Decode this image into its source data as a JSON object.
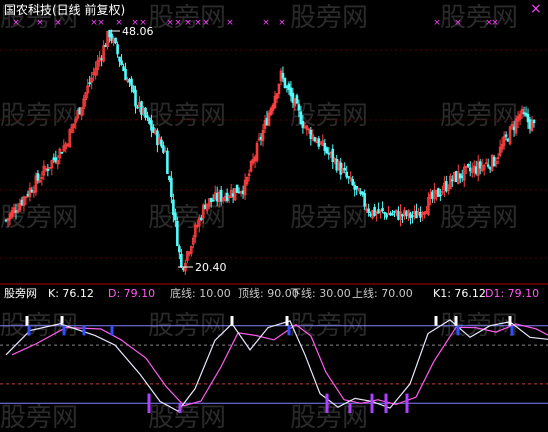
{
  "header": {
    "title": "国农科技(日线 前复权)",
    "close_label": "×"
  },
  "main_panel": {
    "high_label": "48.06",
    "low_label": "20.40",
    "markers": [
      16,
      40,
      58,
      94,
      101,
      119,
      135,
      143,
      170,
      178,
      188,
      198,
      206,
      230,
      266,
      282,
      437,
      458,
      489,
      495
    ]
  },
  "indicator_panel": {
    "name": "股旁网",
    "params": [
      {
        "label": "K: 76.12",
        "color": "#ffffff"
      },
      {
        "label": "D: 79.10",
        "color": "#ff5cf0"
      },
      {
        "label": "底线: 10.00",
        "color": "#c8c8c8"
      },
      {
        "label": "顶线: 90.00",
        "color": "#c8c8c8"
      },
      {
        "label": "下线: 30.00",
        "color": "#c8c8c8"
      },
      {
        "label": "上线: 70.00",
        "color": "#c8c8c8"
      },
      {
        "label": "K1: 76.12",
        "color": "#ffffff"
      },
      {
        "label": "D1: 79.10",
        "color": "#ff5cf0"
      }
    ]
  },
  "watermark": "股旁网",
  "colors": {
    "up": "#ff4040",
    "down": "#54fcfc",
    "axis_red": "#b00000",
    "k_line": "#e8e8ff",
    "d_line": "#ff5cf0",
    "top_bar": "#ffffff",
    "blue_bar": "#3050ff",
    "purple_bar": "#b040ff",
    "marker": "#ff40ff",
    "watermark": "#2a2a2a"
  },
  "chart_data": [
    {
      "type": "candlestick",
      "title": "国农科技(日线 前复权)",
      "annotations": [
        {
          "text": "48.06",
          "value": 48.06,
          "kind": "high"
        },
        {
          "text": "20.40",
          "value": 20.4,
          "kind": "low"
        }
      ],
      "price_range": [
        20.4,
        48.06
      ],
      "trend_points": [
        {
          "day": 0,
          "price": 26.0
        },
        {
          "day": 30,
          "price": 35.0
        },
        {
          "day": 52,
          "price": 48.06
        },
        {
          "day": 65,
          "price": 40.0
        },
        {
          "day": 80,
          "price": 34.0
        },
        {
          "day": 88,
          "price": 20.4
        },
        {
          "day": 100,
          "price": 28.0
        },
        {
          "day": 120,
          "price": 30.0
        },
        {
          "day": 138,
          "price": 43.0
        },
        {
          "day": 150,
          "price": 37.0
        },
        {
          "day": 165,
          "price": 33.0
        },
        {
          "day": 183,
          "price": 27.0
        },
        {
          "day": 205,
          "price": 26.5
        },
        {
          "day": 225,
          "price": 31.0
        },
        {
          "day": 245,
          "price": 33.0
        },
        {
          "day": 258,
          "price": 38.5
        },
        {
          "day": 265,
          "price": 37.0
        }
      ]
    },
    {
      "type": "line",
      "series": [
        {
          "name": "K",
          "last": 76.12
        },
        {
          "name": "D",
          "last": 79.1
        }
      ],
      "reference_lines": [
        {
          "name": "底线",
          "value": 10
        },
        {
          "name": "下线",
          "value": 30
        },
        {
          "name": "上线",
          "value": 70
        },
        {
          "name": "顶线",
          "value": 90
        }
      ],
      "ylim": [
        0,
        100
      ]
    }
  ]
}
